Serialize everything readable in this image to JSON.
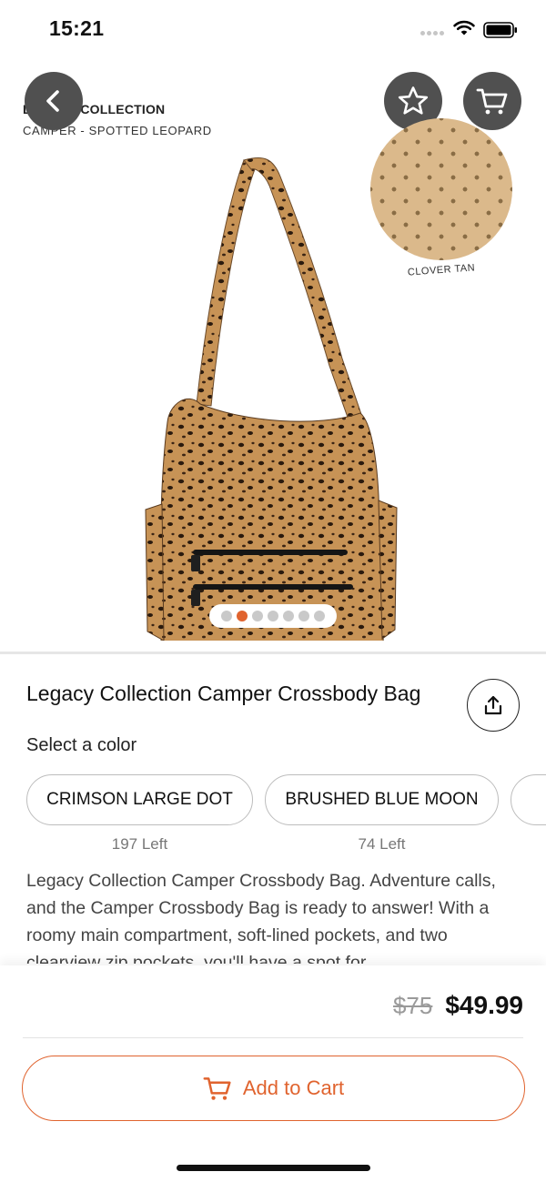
{
  "status_bar": {
    "time": "15:21"
  },
  "hero": {
    "collection_label": "LEGACY COLLECTION",
    "collection_sub": "CAMPER - SPOTTED LEOPARD",
    "swatch_label": "CLOVER TAN",
    "carousel": {
      "count": 7,
      "active_index": 1
    }
  },
  "product": {
    "title": "Legacy Collection Camper Crossbody Bag",
    "select_color_label": "Select a color",
    "colors": [
      {
        "label": "CRIMSON LARGE DOT",
        "left": "197 Left"
      },
      {
        "label": "BRUSHED BLUE MOON",
        "left": "74 Left"
      }
    ],
    "description": "Legacy Collection Camper Crossbody Bag. Adventure calls, and the Camper Crossbody Bag is ready to answer! With a roomy main compartment, soft-lined pockets, and two clearview zip pockets, you'll have a spot for"
  },
  "pricing": {
    "original_price": "$75",
    "sale_price": "$49.99"
  },
  "actions": {
    "add_to_cart_label": "Add to Cart"
  },
  "colors": {
    "accent": "#e0632e",
    "button_dark": "#505050",
    "swatch": "#dbb98b"
  },
  "icons": [
    "back-icon",
    "star-icon",
    "cart-icon",
    "share-icon"
  ]
}
